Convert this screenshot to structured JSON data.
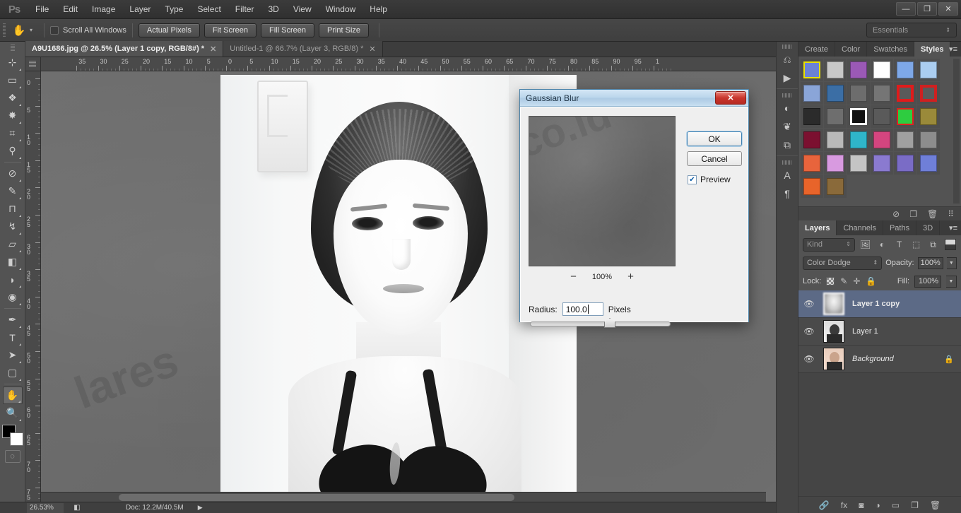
{
  "app": {
    "logo": "Ps",
    "menus": [
      "File",
      "Edit",
      "Image",
      "Layer",
      "Type",
      "Select",
      "Filter",
      "3D",
      "View",
      "Window",
      "Help"
    ],
    "window_controls": {
      "minimize": "—",
      "restore": "❐",
      "close": "✕"
    }
  },
  "options_bar": {
    "tool_icon": "hand-tool",
    "tool_glyph": "✋",
    "caret": "▾",
    "scroll_all_windows_label": "Scroll All Windows",
    "buttons": [
      "Actual Pixels",
      "Fit Screen",
      "Fill Screen",
      "Print Size"
    ],
    "workspace": "Essentials",
    "workspace_spinner": "⇕"
  },
  "toolbar": {
    "tools": [
      {
        "name": "move-tool",
        "glyph": "⊹",
        "active": false
      },
      {
        "name": "rectangular-marquee-tool",
        "glyph": "▭",
        "active": false
      },
      {
        "name": "lasso-tool",
        "glyph": "❖",
        "active": false
      },
      {
        "name": "quick-selection-tool",
        "glyph": "✸",
        "active": false
      },
      {
        "name": "crop-tool",
        "glyph": "⌗",
        "active": false
      },
      {
        "name": "eyedropper-tool",
        "glyph": "⚲",
        "active": false
      },
      {
        "name": "spot-healing-brush-tool",
        "glyph": "⊘",
        "active": false
      },
      {
        "name": "brush-tool",
        "glyph": "✎",
        "active": false
      },
      {
        "name": "clone-stamp-tool",
        "glyph": "⊓",
        "active": false
      },
      {
        "name": "history-brush-tool",
        "glyph": "↯",
        "active": false
      },
      {
        "name": "eraser-tool",
        "glyph": "▱",
        "active": false
      },
      {
        "name": "gradient-tool",
        "glyph": "◧",
        "active": false
      },
      {
        "name": "blur-tool",
        "glyph": "◗",
        "active": false
      },
      {
        "name": "dodge-tool",
        "glyph": "◉",
        "active": false
      },
      {
        "name": "pen-tool",
        "glyph": "✒",
        "active": false
      },
      {
        "name": "type-tool",
        "glyph": "T",
        "active": false
      },
      {
        "name": "path-selection-tool",
        "glyph": "➤",
        "active": false
      },
      {
        "name": "rectangle-tool",
        "glyph": "▢",
        "active": false
      },
      {
        "name": "hand-tool",
        "glyph": "✋",
        "active": true
      },
      {
        "name": "zoom-tool",
        "glyph": "🔍",
        "active": false
      }
    ],
    "foreground_color": "#000000",
    "background_color": "#ffffff",
    "quickmask_glyph": "◌"
  },
  "tabs": [
    {
      "title": "A9U1686.jpg @ 26.5% (Layer 1 copy, RGB/8#) *",
      "active": true,
      "close": "✕"
    },
    {
      "title": "Untitled-1 @ 66.7% (Layer 3, RGB/8) *",
      "active": false,
      "close": "✕"
    }
  ],
  "rulers": {
    "horizontal_labels": [
      "35",
      "30",
      "25",
      "20",
      "15",
      "10",
      "5",
      "0",
      "5",
      "10",
      "15",
      "20",
      "25",
      "30",
      "35",
      "40",
      "45",
      "50",
      "55",
      "60",
      "65",
      "70",
      "75",
      "80",
      "85",
      "90",
      "95",
      "1"
    ],
    "vertical_labels": [
      "0",
      "5",
      "10",
      "15",
      "20",
      "25",
      "30",
      "35",
      "40",
      "45",
      "50",
      "55",
      "60",
      "65",
      "70",
      "75"
    ],
    "units": "Pixels"
  },
  "canvas": {
    "watermark": "lares",
    "background_color": "#6e6e6e"
  },
  "dialog": {
    "title": "Gaussian Blur",
    "close_glyph": "✕",
    "preview_watermark": "co.id",
    "zoom_minus": "−",
    "zoom_value": "100%",
    "zoom_plus": "+",
    "radius_label": "Radius:",
    "radius_value": "100.0",
    "radius_units": "Pixels",
    "ok_label": "OK",
    "cancel_label": "Cancel",
    "preview_label": "Preview",
    "preview_checked": true,
    "check_glyph": "✔"
  },
  "icon_dock": [
    {
      "name": "history-panel-icon",
      "glyph": "⎌"
    },
    {
      "name": "actions-panel-icon",
      "glyph": "▶"
    },
    {
      "name": "adjustments-panel-icon",
      "glyph": "◐"
    },
    {
      "name": "brush-panel-icon",
      "glyph": "❦"
    },
    {
      "name": "clone-source-panel-icon",
      "glyph": "⧉"
    },
    {
      "name": "character-panel-icon",
      "glyph": "A"
    },
    {
      "name": "paragraph-panel-icon",
      "glyph": "¶"
    }
  ],
  "styles_panel": {
    "tabs": [
      {
        "label": "Create",
        "active": false
      },
      {
        "label": "Color",
        "active": false
      },
      {
        "label": "Swatches",
        "active": false
      },
      {
        "label": "Styles",
        "active": true
      }
    ],
    "menu_glyph": "▾≡",
    "swatches": [
      "#6b82d6",
      "#c8c8c8",
      "#9b59b6",
      "#ffffff",
      "#7ea8e8",
      "#aacdf0",
      "#8aa5d8",
      "#3b6ea5",
      "#6d6d6d",
      "#757575",
      "#e01b1b",
      "#cf2020",
      "#2b2b2b",
      "#6e6e6e",
      "#111111",
      "#5a5a5a",
      "#2ecc40",
      "#9a8a3a",
      "#7b1030",
      "#b9b9b9",
      "#2fb5c9",
      "#d4457f",
      "#a0a0a0",
      "#8d8d8d",
      "#e8643c",
      "#d89ae0",
      "#c4c4c4",
      "#8a7ad0",
      "#7a6cc6",
      "#6f7fd8",
      "#e8642a",
      "#8a6a3a"
    ]
  },
  "layers_panel": {
    "tabs": [
      {
        "label": "Layers",
        "active": true
      },
      {
        "label": "Channels",
        "active": false
      },
      {
        "label": "Paths",
        "active": false
      },
      {
        "label": "3D",
        "active": false
      }
    ],
    "menu_glyph": "▾≡",
    "toolstrip_icons": [
      "no-entry-icon",
      "new-layer-icon",
      "trash-icon"
    ],
    "filter_kind": "Kind",
    "filter_spinner": "⇕",
    "filter_icons": [
      "pixel-layer-filter-icon",
      "adjustment-layer-filter-icon",
      "type-layer-filter-icon",
      "shape-layer-filter-icon",
      "smart-object-filter-icon"
    ],
    "blend_mode": "Color Dodge",
    "blend_spinner": "⇕",
    "opacity_label": "Opacity:",
    "opacity_value": "100%",
    "fill_label": "Fill:",
    "fill_value": "100%",
    "lock_label": "Lock:",
    "lock_icons": [
      "lock-transparency-icon",
      "lock-image-pixels-icon",
      "lock-position-icon",
      "lock-all-icon"
    ],
    "layers": [
      {
        "name": "Layer 1 copy",
        "visible": true,
        "selected": true,
        "italic": false,
        "locked": false,
        "thumb": "blur"
      },
      {
        "name": "Layer 1",
        "visible": true,
        "selected": false,
        "italic": false,
        "locked": false,
        "thumb": "gray"
      },
      {
        "name": "Background",
        "visible": true,
        "selected": false,
        "italic": true,
        "locked": true,
        "thumb": "color"
      }
    ],
    "eye_glyph": "👁",
    "lock_glyph": "🔒",
    "bottom_icons": [
      "link-layers-icon",
      "add-layer-style-icon",
      "add-layer-mask-icon",
      "new-adjustment-layer-icon",
      "new-group-icon",
      "new-layer-icon",
      "delete-layer-icon"
    ],
    "bottom_glyphs": [
      "🔗",
      "fx",
      "◙",
      "◑",
      "▭",
      "❐",
      "🗑"
    ]
  },
  "status_bar": {
    "zoom": "26.53%",
    "doc_icon": "document-icon",
    "doc": "Doc: 12.2M/40.5M",
    "arrow": "▶"
  }
}
